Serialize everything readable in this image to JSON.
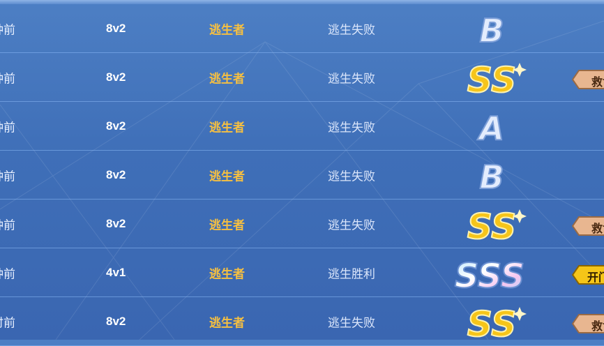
{
  "rows": [
    {
      "time": "种前",
      "mode": "8v2",
      "role": "逃生者",
      "result": "逃生失败",
      "grade": "B",
      "badge": ""
    },
    {
      "time": "种前",
      "mode": "8v2",
      "role": "逃生者",
      "result": "逃生失败",
      "grade": "SS",
      "badge": "救世主"
    },
    {
      "time": "种前",
      "mode": "8v2",
      "role": "逃生者",
      "result": "逃生失败",
      "grade": "A",
      "badge": ""
    },
    {
      "time": "种前",
      "mode": "8v2",
      "role": "逃生者",
      "result": "逃生失败",
      "grade": "B",
      "badge": ""
    },
    {
      "time": "种前",
      "mode": "8v2",
      "role": "逃生者",
      "result": "逃生失败",
      "grade": "SS",
      "badge": "救世主"
    },
    {
      "time": "种前",
      "mode": "4v1",
      "role": "逃生者",
      "result": "逃生胜利",
      "grade": "SSS",
      "badge": "开门英雄"
    },
    {
      "time": "时前",
      "mode": "8v2",
      "role": "逃生者",
      "result": "逃生失败",
      "grade": "SS",
      "badge": "救世主"
    }
  ],
  "colors": {
    "role": "#f7c040",
    "gold": "#f5c518",
    "bronze": "#d9a27a",
    "silver": "#dfe9fb"
  }
}
